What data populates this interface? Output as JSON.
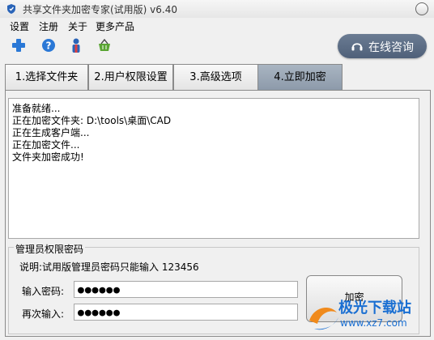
{
  "window": {
    "title": "共享文件夹加密专家(试用版) v6.40"
  },
  "menu": [
    "设置",
    "注册",
    "关于",
    "更多产品"
  ],
  "toolbar": {
    "icons": [
      "add-icon",
      "help-icon",
      "user-icon",
      "basket-icon"
    ]
  },
  "consult_button": "在线咨询",
  "tabs": [
    "1.选择文件夹",
    "2.用户权限设置",
    "3.高级选项",
    "4.立即加密"
  ],
  "active_tab_index": 3,
  "log": [
    "准备就绪...",
    "正在加密文件夹: D:\\tools\\桌面\\CAD",
    "正在生成客户端...",
    "正在加密文件...",
    "文件夹加密成功!"
  ],
  "admin": {
    "group_title": "管理员权限密码",
    "note": "说明:试用版管理员密码只能输入 123456",
    "password_label": "输入密码:",
    "password_value": "●●●●●●",
    "confirm_label": "再次输入:",
    "confirm_value": "●●●●●●"
  },
  "encrypt_button": "加密",
  "watermark": {
    "name": "极光下载站",
    "url": "www.xz7.com"
  },
  "colors": {
    "active_tab": "#9aa6b4",
    "consult_button": "#5a6b84",
    "watermark": "#1a6fd2"
  }
}
